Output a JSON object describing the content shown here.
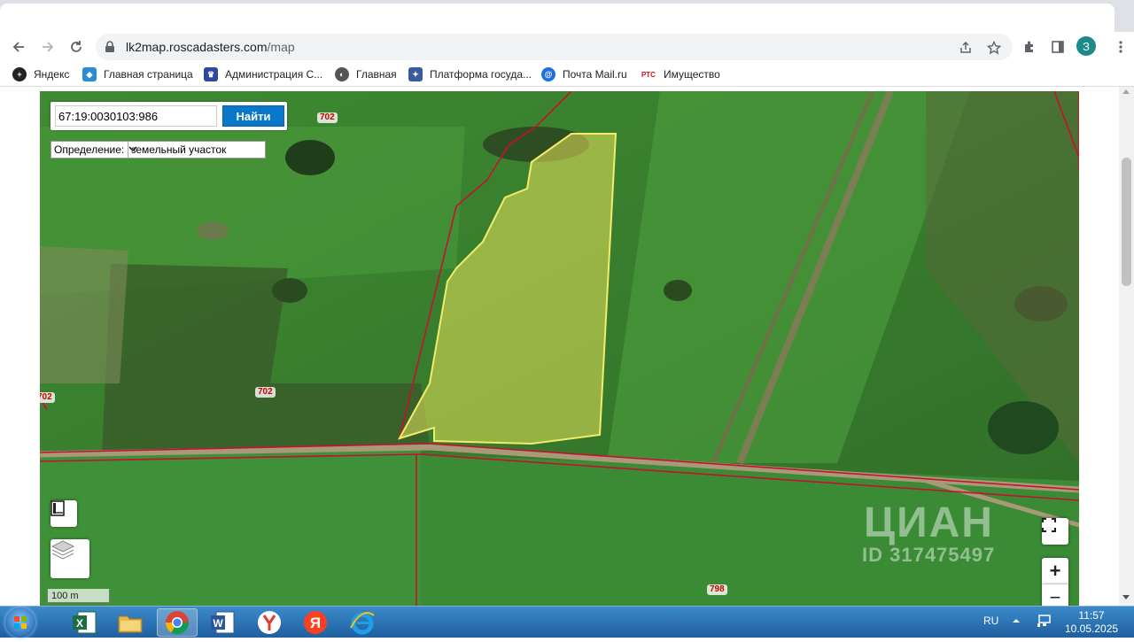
{
  "browser": {
    "url_host": "lk2map.roscadasters.com",
    "url_path": "/map",
    "profile_initial": "З"
  },
  "bookmarks": [
    {
      "label": "Яндекс",
      "icon": "yandex-icon"
    },
    {
      "label": "Главная страница",
      "icon": "gosuslugi-icon"
    },
    {
      "label": "Администрация С...",
      "icon": "emblem-icon"
    },
    {
      "label": "Главная",
      "icon": "globe-icon"
    },
    {
      "label": "Платформа госуда...",
      "icon": "eagle-icon"
    },
    {
      "label": "Почта Mail.ru",
      "icon": "mail-icon"
    },
    {
      "label": "Имущество",
      "icon": "rts-icon"
    }
  ],
  "map": {
    "search_value": "67:19:0030103:986",
    "find_label": "Найти",
    "definition_label": "Определение:",
    "definition_value": "земельный участок",
    "scale_label": "100 m",
    "zoom_in": "+",
    "zoom_out": "−",
    "cad_labels": [
      "702",
      "702",
      "702",
      "798"
    ],
    "watermark_brand": "ЦИАН",
    "watermark_id": "ID 317475497",
    "parcel_color": "#e8e25a",
    "boundary_color": "#c8102e"
  },
  "taskbar": {
    "lang": "RU",
    "time": "11:57",
    "date": "10.05.2025",
    "apps": [
      "excel-icon",
      "explorer-icon",
      "chrome-icon",
      "word-icon",
      "yandex-browser-icon",
      "yandex-icon",
      "ie-icon"
    ]
  }
}
